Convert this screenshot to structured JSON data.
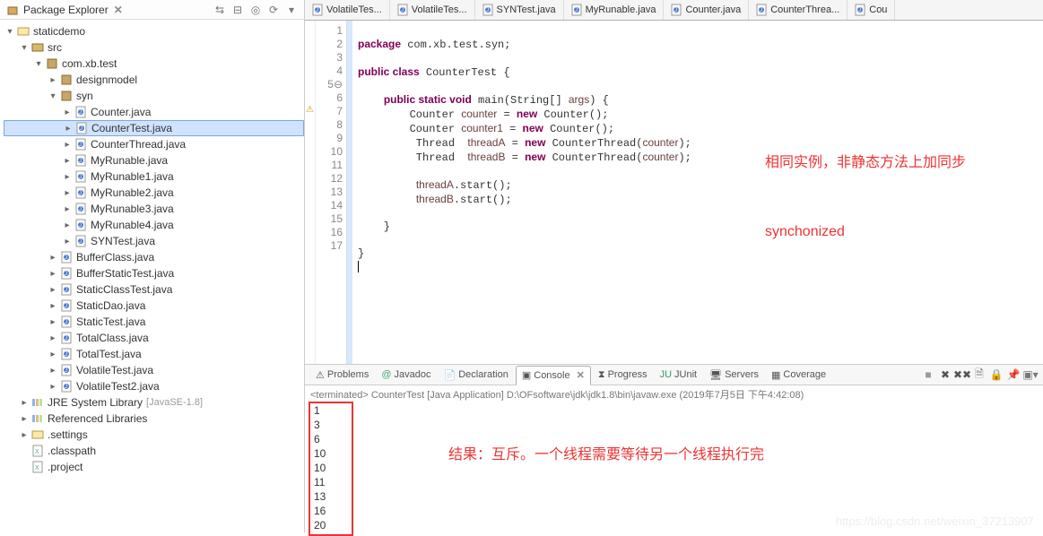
{
  "sidebar": {
    "title": "Package Explorer",
    "toolbar_icons": [
      "link-icon",
      "collapse-icon",
      "focus-icon",
      "menu-icon"
    ],
    "tree": {
      "root": "staticdemo",
      "src": "src",
      "pkg": "com.xb.test",
      "subpkg1": "designmodel",
      "subpkg2": "syn",
      "files_syn": [
        "Counter.java",
        "CounterTest.java",
        "CounterThread.java",
        "MyRunable.java",
        "MyRunable1.java",
        "MyRunable2.java",
        "MyRunable3.java",
        "MyRunable4.java",
        "SYNTest.java"
      ],
      "files_test": [
        "BufferClass.java",
        "BufferStaticTest.java",
        "StaticClassTest.java",
        "StaticDao.java",
        "StaticTest.java",
        "TotalClass.java",
        "TotalTest.java",
        "VolatileTest.java",
        "VolatileTest2.java"
      ],
      "jre": "JRE System Library",
      "jre_ver": "[JavaSE-1.8]",
      "reflib": "Referenced Libraries",
      "settings": ".settings",
      "classpath": ".classpath",
      "project": ".project"
    }
  },
  "tabs": [
    "VolatileTes...",
    "VolatileTes...",
    "SYNTest.java",
    "MyRunable.java",
    "Counter.java",
    "CounterThrea...",
    "Cou"
  ],
  "code": {
    "lines_n": 17,
    "l1": "package com.xb.test.syn;",
    "l3a": "public class ",
    "l3b": "CounterTest {",
    "l5a": "    public static void ",
    "l5b": "main(String[] ",
    "l5c": "args",
    "l6a": "        Counter ",
    "l6b": "counter",
    "l6c": " = ",
    "l6d": "new",
    "l6e": " Counter();",
    "l7a": "        Counter ",
    "l7b": "counter1",
    "l7c": " = ",
    "l7d": "new",
    "l7e": " Counter();",
    "l8a": "         Thread  ",
    "l8b": "threadA",
    "l8c": " = ",
    "l8d": "new",
    "l8e": " CounterThread(",
    "l8f": "counter",
    "l8g": ");",
    "l9a": "         Thread  ",
    "l9b": "threadB",
    "l9c": " = ",
    "l9d": "new",
    "l9e": " CounterThread(",
    "l9f": "counter",
    "l9g": ");",
    "l11a": "         ",
    "l11b": "threadA",
    "l11c": ".start();",
    "l12a": "         ",
    "l12b": "threadB",
    "l12c": ".start();",
    "l14": "    }",
    "l16": "}",
    "l17": ""
  },
  "annotation": {
    "line1": "相同实例，非静态方法上加同步",
    "line2": "synchonized"
  },
  "bottom_tabs": {
    "problems": "Problems",
    "javadoc": "Javadoc",
    "declaration": "Declaration",
    "console": "Console",
    "progress": "Progress",
    "junit": "JUnit",
    "servers": "Servers",
    "coverage": "Coverage"
  },
  "console": {
    "status": "<terminated> CounterTest [Java Application] D:\\OFsoftware\\jdk\\jdk1.8\\bin\\javaw.exe (2019年7月5日 下午4:42:08)",
    "output": [
      "1",
      "3",
      "6",
      "10",
      "10",
      "11",
      "13",
      "16",
      "20"
    ],
    "annotation": "结果：互斥。一个线程需要等待另一个线程执行完"
  },
  "watermark": "https://blog.csdn.net/weixin_37213907"
}
